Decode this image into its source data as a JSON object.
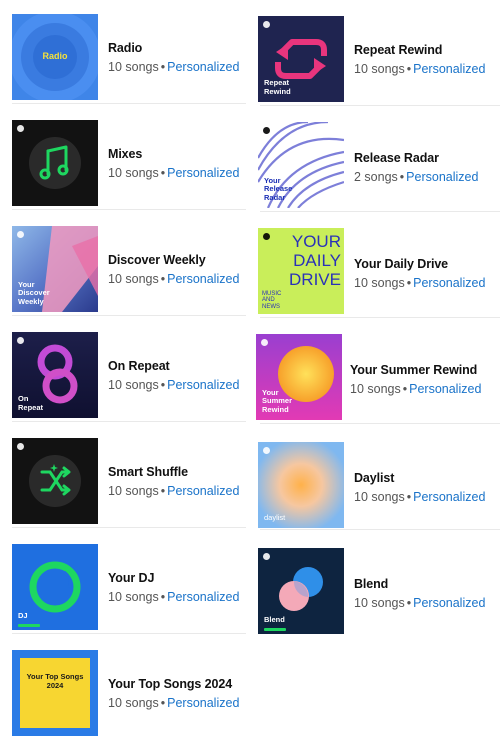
{
  "left": [
    {
      "title": "Radio",
      "count": "10 songs",
      "tag": "Personalized",
      "cover": "radio-circles",
      "cover_label": "Radio"
    },
    {
      "title": "Mixes",
      "count": "10 songs",
      "tag": "Personalized",
      "cover": "music-note",
      "cover_label": ""
    },
    {
      "title": "Discover Weekly",
      "count": "10 songs",
      "tag": "Personalized",
      "cover": "gradient-pink",
      "cover_label": "Your Discover Weekly"
    },
    {
      "title": "On Repeat",
      "count": "10 songs",
      "tag": "Personalized",
      "cover": "loop-eight",
      "cover_label": "On Repeat"
    },
    {
      "title": "Smart Shuffle",
      "count": "10 songs",
      "tag": "Personalized",
      "cover": "shuffle",
      "cover_label": ""
    },
    {
      "title": "Your DJ",
      "count": "10 songs",
      "tag": "Personalized",
      "cover": "dj-ring",
      "cover_label": "DJ"
    },
    {
      "title": "Your Top Songs 2024",
      "count": "10 songs",
      "tag": "Personalized",
      "cover": "top-songs-2024",
      "cover_label": "Your Top Songs 2024"
    }
  ],
  "right": [
    {
      "title": "Repeat Rewind",
      "count": "10 songs",
      "tag": "Personalized",
      "cover": "rewind-arrows",
      "cover_label": "Repeat Rewind"
    },
    {
      "title": "Release Radar",
      "count": "2 songs",
      "tag": "Personalized",
      "cover": "wavy-lines",
      "cover_label": "Your Release Radar"
    },
    {
      "title": "Your Daily Drive",
      "count": "10 songs",
      "tag": "Personalized",
      "cover": "daily-drive",
      "cover_label": "YOUR DAILY DRIVE",
      "cover_sub": "MUSIC AND NEWS"
    },
    {
      "title": "Your Summer Rewind",
      "count": "10 songs",
      "tag": "Personalized",
      "cover": "summer-sun",
      "cover_label": "Your Summer Rewind"
    },
    {
      "title": "Daylist",
      "count": "10 songs",
      "tag": "Personalized",
      "cover": "daylist-glow",
      "cover_label": "daylist"
    },
    {
      "title": "Blend",
      "count": "10 songs",
      "tag": "Personalized",
      "cover": "blend-circles",
      "cover_label": "Blend"
    }
  ],
  "separator": "•",
  "colors": {
    "tag": "#1a73c9",
    "green": "#1ed760",
    "blue": "#1b2fb5"
  }
}
